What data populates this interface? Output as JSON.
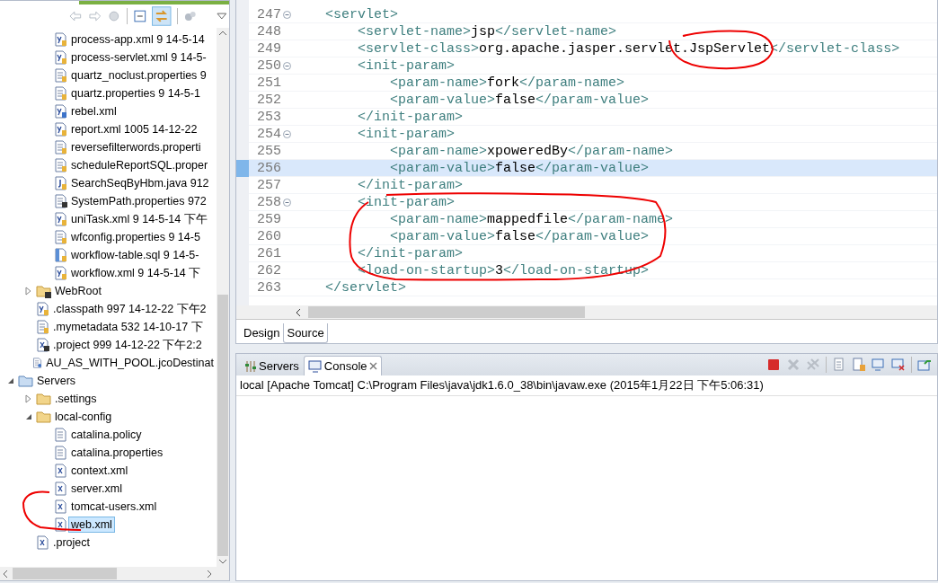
{
  "explorer": {
    "tree": [
      {
        "children": [
          {
            "children": [
              {
                "label": "process-app.xml 9  14-5-14",
                "kind": "spring",
                "selected": false
              },
              {
                "label": "process-servlet.xml 9  14-5-",
                "kind": "spring",
                "selected": false
              },
              {
                "label": "quartz_noclust.properties 9",
                "kind": "props",
                "selected": false
              },
              {
                "label": "quartz.properties 9  14-5-1",
                "kind": "props",
                "selected": false
              },
              {
                "label": "rebel.xml",
                "kind": "springq",
                "selected": false
              },
              {
                "label": "report.xml 1005  14-12-22",
                "kind": "spring",
                "selected": false
              },
              {
                "label": "reversefilterwords.properti",
                "kind": "props",
                "selected": false
              },
              {
                "label": "scheduleReportSQL.proper",
                "kind": "props",
                "selected": false
              },
              {
                "label": "SearchSeqByHbm.java 912",
                "kind": "java",
                "selected": false
              },
              {
                "label": "SystemPath.properties 972",
                "kind": "propsmod",
                "selected": false
              },
              {
                "label": "uniTask.xml 9  14-5-14 下午",
                "kind": "spring",
                "selected": false
              },
              {
                "label": "wfconfig.properties 9  14-5",
                "kind": "props",
                "selected": false
              },
              {
                "label": "workflow-table.sql 9  14-5-",
                "kind": "sql",
                "selected": false
              },
              {
                "label": "workflow.xml 9  14-5-14 下",
                "kind": "spring",
                "selected": false
              }
            ]
          },
          {
            "label": "WebRoot",
            "kind": "foldermod",
            "expanded": false,
            "selected": false
          },
          {
            "label": ".classpath 997  14-12-22 下午2",
            "kind": "spring",
            "selected": false
          },
          {
            "label": ".mymetadata 532  14-10-17 下",
            "kind": "props",
            "selected": false
          },
          {
            "label": ".project 999  14-12-22 下午2:2",
            "kind": "xmlmod",
            "selected": false
          },
          {
            "label": "AU_AS_WITH_POOL.jcoDestinat",
            "kind": "propsq",
            "selected": false
          }
        ]
      },
      {
        "label": "Servers",
        "kind": "folderopen",
        "expanded": true,
        "selected": false,
        "children": [
          {
            "label": ".settings",
            "kind": "folder",
            "expanded": false,
            "selected": false
          },
          {
            "label": "local-config",
            "kind": "folder",
            "expanded": true,
            "selected": false,
            "children": [
              {
                "label": "catalina.policy",
                "kind": "text",
                "selected": false
              },
              {
                "label": "catalina.properties",
                "kind": "text",
                "selected": false
              },
              {
                "label": "context.xml",
                "kind": "xml",
                "selected": false
              },
              {
                "label": "server.xml",
                "kind": "xml",
                "selected": false
              },
              {
                "label": "tomcat-users.xml",
                "kind": "xml",
                "selected": false
              },
              {
                "label": "web.xml",
                "kind": "xml",
                "selected": true
              }
            ]
          },
          {
            "label": ".project",
            "kind": "xml",
            "selected": false
          }
        ]
      }
    ]
  },
  "editor": {
    "lines": [
      {
        "number": "247",
        "code": "    <servlet>",
        "fold": true,
        "current": false
      },
      {
        "number": "248",
        "code": "        <servlet-name>jsp</servlet-name>",
        "fold": false,
        "current": false
      },
      {
        "number": "249",
        "code": "        <servlet-class>org.apache.jasper.servlet.JspServlet</servlet-class>",
        "fold": false,
        "current": false
      },
      {
        "number": "250",
        "code": "        <init-param>",
        "fold": true,
        "current": false
      },
      {
        "number": "251",
        "code": "            <param-name>fork</param-name>",
        "fold": false,
        "current": false
      },
      {
        "number": "252",
        "code": "            <param-value>false</param-value>",
        "fold": false,
        "current": false
      },
      {
        "number": "253",
        "code": "        </init-param>",
        "fold": false,
        "current": false
      },
      {
        "number": "254",
        "code": "        <init-param>",
        "fold": true,
        "current": false
      },
      {
        "number": "255",
        "code": "            <param-name>xpoweredBy</param-name>",
        "fold": false,
        "current": false
      },
      {
        "number": "256",
        "code": "            <param-value>false</param-value>",
        "fold": false,
        "current": true
      },
      {
        "number": "257",
        "code": "        </init-param>",
        "fold": false,
        "current": false
      },
      {
        "number": "258",
        "code": "        <init-param>",
        "fold": true,
        "current": false
      },
      {
        "number": "259",
        "code": "            <param-name>mappedfile</param-name>",
        "fold": false,
        "current": false
      },
      {
        "number": "260",
        "code": "            <param-value>false</param-value>",
        "fold": false,
        "current": false
      },
      {
        "number": "261",
        "code": "        </init-param>",
        "fold": false,
        "current": false
      },
      {
        "number": "262",
        "code": "        <load-on-startup>3</load-on-startup>",
        "fold": false,
        "current": false
      },
      {
        "number": "263",
        "code": "    </servlet>",
        "fold": false,
        "current": false
      }
    ],
    "tabs": [
      {
        "label": "Design",
        "selected": false
      },
      {
        "label": "Source",
        "selected": true
      }
    ]
  },
  "console": {
    "tabs": [
      {
        "label": "Servers",
        "kind": "servers",
        "selected": false
      },
      {
        "label": "Console",
        "kind": "console",
        "selected": true
      }
    ],
    "toolbar": [
      {
        "kind": "stop"
      },
      {
        "kind": "remove"
      },
      {
        "kind": "removeall"
      },
      {
        "kind": "copy"
      },
      {
        "kind": "pin"
      },
      {
        "kind": "display"
      },
      {
        "kind": "open"
      },
      {
        "kind": "new"
      }
    ],
    "title": "local [Apache Tomcat] C:\\Program Files\\java\\jdk1.6.0_38\\bin\\javaw.exe (2015年1月22日 下午5:06:31)"
  }
}
